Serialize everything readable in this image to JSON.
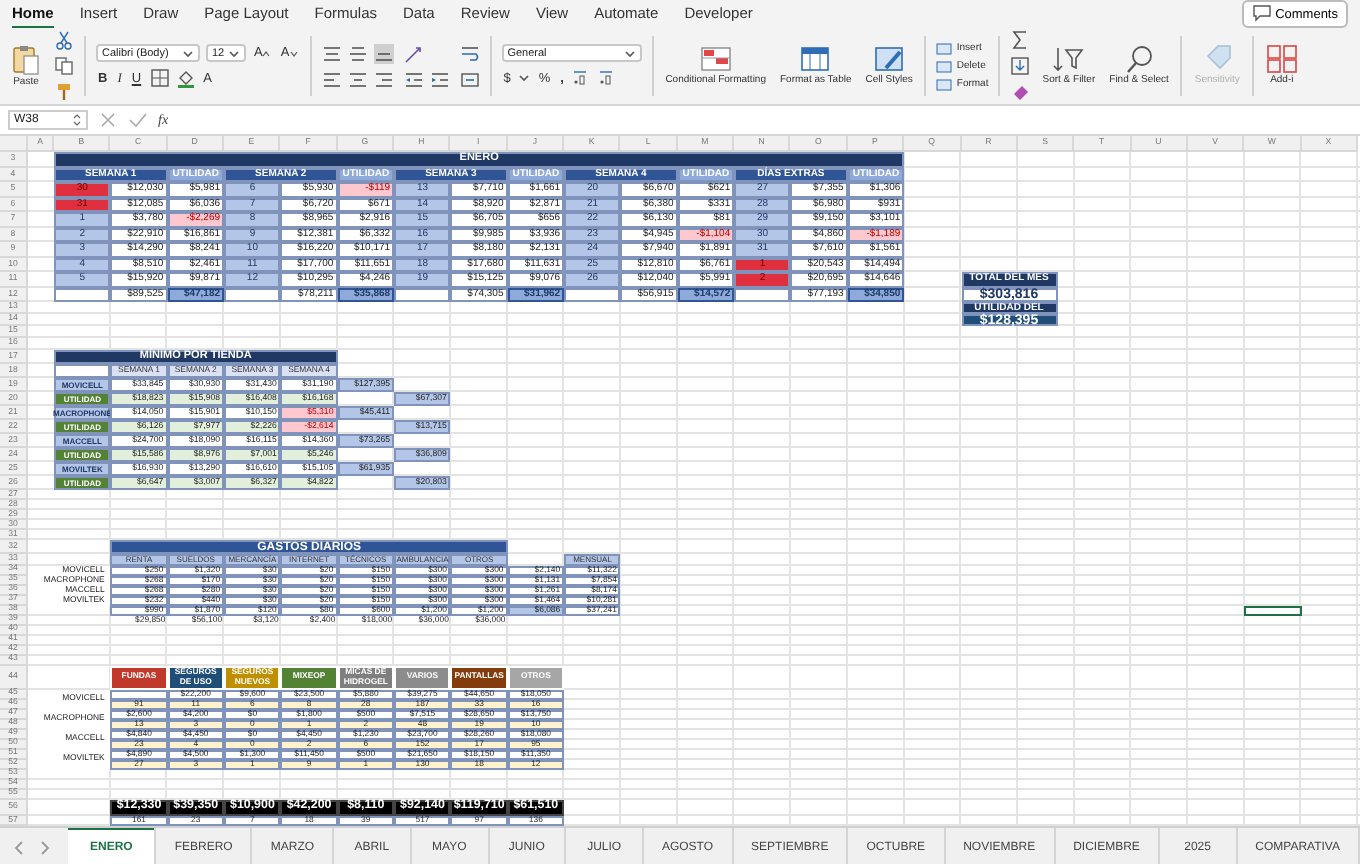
{
  "ribbon_tabs": [
    {
      "label": "Home",
      "selected": true
    },
    {
      "label": "Insert",
      "selected": false
    },
    {
      "label": "Draw",
      "selected": false
    },
    {
      "label": "Page Layout",
      "selected": false
    },
    {
      "label": "Formulas",
      "selected": false
    },
    {
      "label": "Data",
      "selected": false
    },
    {
      "label": "Review",
      "selected": false
    },
    {
      "label": "View",
      "selected": false
    },
    {
      "label": "Automate",
      "selected": false
    },
    {
      "label": "Developer",
      "selected": false
    }
  ],
  "comments_button": "Comments",
  "ribbon": {
    "paste": "Paste",
    "font": "Calibri (Body)",
    "font_size": "12",
    "grow_font": "A",
    "shrink_font": "A",
    "bold": "B",
    "italic": "I",
    "underline": "U",
    "font_color": "A",
    "number_format": "General",
    "currency": "$",
    "percent": "%",
    "comma": ",",
    "cells_menu": [
      "Insert",
      "Delete",
      "Format"
    ],
    "large_buttons": [
      {
        "kind": "conditional",
        "label": "Conditional Formatting",
        "disabled": false
      },
      {
        "kind": "table",
        "label": "Format as Table",
        "disabled": false
      },
      {
        "kind": "styles",
        "label": "Cell Styles",
        "disabled": false
      },
      {
        "kind": "sort",
        "label": "Sort & Filter",
        "disabled": false
      },
      {
        "kind": "find",
        "label": "Find & Select",
        "disabled": false
      },
      {
        "kind": "sensitivity",
        "label": "Sensitivity",
        "disabled": true
      },
      {
        "kind": "addins",
        "label": "Add-i",
        "disabled": false
      }
    ]
  },
  "formula_bar": {
    "name_box": "W38",
    "fx": "fx"
  },
  "column_letters": [
    "A",
    "B",
    "C",
    "D",
    "E",
    "F",
    "G",
    "H",
    "I",
    "J",
    "K",
    "L",
    "M",
    "N",
    "O",
    "P",
    "Q",
    "R",
    "S",
    "T",
    "U",
    "V",
    "W",
    "X"
  ],
  "row_numbers": [
    "3",
    "4",
    "5",
    "6",
    "7",
    "8",
    "9",
    "10",
    "11",
    "12",
    "13",
    "14",
    "15",
    "16",
    "17",
    "18",
    "19",
    "20",
    "21",
    "22",
    "23",
    "24",
    "25",
    "26",
    "27",
    "28",
    "29",
    "30",
    "31",
    "32",
    "33",
    "34",
    "35",
    "36",
    "37",
    "38",
    "39",
    "40",
    "41",
    "42",
    "43",
    "44",
    "45",
    "46",
    "47",
    "48",
    "49",
    "50",
    "51",
    "52",
    "53",
    "54",
    "55",
    "56",
    "57"
  ],
  "enero": {
    "title": "ENERO",
    "groups": [
      {
        "header": "SEMANA 1",
        "utility_header": "UTILIDAD",
        "total": "$89,525",
        "utility_total": "$47,182",
        "rows": [
          {
            "day": "30",
            "alert": true,
            "amount": "$12,030",
            "utility": "$5,981",
            "negative": false
          },
          {
            "day": "31",
            "alert": true,
            "amount": "$12,085",
            "utility": "$6,036",
            "negative": false
          },
          {
            "day": "1",
            "alert": false,
            "amount": "$3,780",
            "utility": "-$2,269",
            "negative": true
          },
          {
            "day": "2",
            "alert": false,
            "amount": "$22,910",
            "utility": "$16,861",
            "negative": false
          },
          {
            "day": "3",
            "alert": false,
            "amount": "$14,290",
            "utility": "$8,241",
            "negative": false
          },
          {
            "day": "4",
            "alert": false,
            "amount": "$8,510",
            "utility": "$2,461",
            "negative": false
          },
          {
            "day": "5",
            "alert": false,
            "amount": "$15,920",
            "utility": "$9,871",
            "negative": false
          }
        ]
      },
      {
        "header": "SEMANA 2",
        "utility_header": "UTILIDAD",
        "total": "$78,211",
        "utility_total": "$35,868",
        "rows": [
          {
            "day": "6",
            "alert": false,
            "amount": "$5,930",
            "utility": "-$119",
            "negative": true
          },
          {
            "day": "7",
            "alert": false,
            "amount": "$6,720",
            "utility": "$671",
            "negative": false
          },
          {
            "day": "8",
            "alert": false,
            "amount": "$8,965",
            "utility": "$2,916",
            "negative": false
          },
          {
            "day": "9",
            "alert": false,
            "amount": "$12,381",
            "utility": "$6,332",
            "negative": false
          },
          {
            "day": "10",
            "alert": false,
            "amount": "$16,220",
            "utility": "$10,171",
            "negative": false
          },
          {
            "day": "11",
            "alert": false,
            "amount": "$17,700",
            "utility": "$11,651",
            "negative": false
          },
          {
            "day": "12",
            "alert": false,
            "amount": "$10,295",
            "utility": "$4,246",
            "negative": false
          }
        ]
      },
      {
        "header": "SEMANA 3",
        "utility_header": "UTILIDAD",
        "total": "$74,305",
        "utility_total": "$31,962",
        "rows": [
          {
            "day": "13",
            "alert": false,
            "amount": "$7,710",
            "utility": "$1,661",
            "negative": false
          },
          {
            "day": "14",
            "alert": false,
            "amount": "$8,920",
            "utility": "$2,871",
            "negative": false
          },
          {
            "day": "15",
            "alert": false,
            "amount": "$6,705",
            "utility": "$656",
            "negative": false
          },
          {
            "day": "16",
            "alert": false,
            "amount": "$9,985",
            "utility": "$3,936",
            "negative": false
          },
          {
            "day": "17",
            "alert": false,
            "amount": "$8,180",
            "utility": "$2,131",
            "negative": false
          },
          {
            "day": "18",
            "alert": false,
            "amount": "$17,680",
            "utility": "$11,631",
            "negative": false
          },
          {
            "day": "19",
            "alert": false,
            "amount": "$15,125",
            "utility": "$9,076",
            "negative": false
          }
        ]
      },
      {
        "header": "SEMANA 4",
        "utility_header": "UTILIDAD",
        "total": "$56,915",
        "utility_total": "$14,572",
        "rows": [
          {
            "day": "20",
            "alert": false,
            "amount": "$6,670",
            "utility": "$621",
            "negative": false
          },
          {
            "day": "21",
            "alert": false,
            "amount": "$6,380",
            "utility": "$331",
            "negative": false
          },
          {
            "day": "22",
            "alert": false,
            "amount": "$6,130",
            "utility": "$81",
            "negative": false
          },
          {
            "day": "23",
            "alert": false,
            "amount": "$4,945",
            "utility": "-$1,104",
            "negative": true
          },
          {
            "day": "24",
            "alert": false,
            "amount": "$7,940",
            "utility": "$1,891",
            "negative": false
          },
          {
            "day": "25",
            "alert": false,
            "amount": "$12,810",
            "utility": "$6,761",
            "negative": false
          },
          {
            "day": "26",
            "alert": false,
            "amount": "$12,040",
            "utility": "$5,991",
            "negative": false
          }
        ]
      },
      {
        "header": "DÍAS EXTRAS",
        "utility_header": "UTILIDAD",
        "total": "$77,193",
        "utility_total": "$34,850",
        "rows": [
          {
            "day": "27",
            "alert": false,
            "amount": "$7,355",
            "utility": "$1,306",
            "negative": false
          },
          {
            "day": "28",
            "alert": false,
            "amount": "$6,980",
            "utility": "$931",
            "negative": false
          },
          {
            "day": "29",
            "alert": false,
            "amount": "$9,150",
            "utility": "$3,101",
            "negative": false
          },
          {
            "day": "30",
            "alert": false,
            "amount": "$4,860",
            "utility": "-$1,189",
            "negative": true
          },
          {
            "day": "31",
            "alert": false,
            "amount": "$7,610",
            "utility": "$1,561",
            "negative": false
          },
          {
            "day": "1",
            "alert": true,
            "amount": "$20,543",
            "utility": "$14,494",
            "negative": false
          },
          {
            "day": "2",
            "alert": true,
            "amount": "$20,695",
            "utility": "$14,646",
            "negative": false
          }
        ]
      }
    ]
  },
  "month_summary": {
    "total_label": "TOTAL DEL MES",
    "total": "$303,816",
    "utility_label": "UTILIDAD DEL",
    "utility": "$128,395"
  },
  "minimo": {
    "title": "MÍNIMO POR TIENDA",
    "headers": [
      "SEMANA 1",
      "SEMANA 2",
      "SEMANA 3",
      "SEMANA 4"
    ],
    "rows": [
      {
        "kind": "store",
        "label": "MOVICELL",
        "sum": "$127,395",
        "values": [
          {
            "text": "$33,845",
            "negative": false
          },
          {
            "text": "$30,930",
            "negative": false
          },
          {
            "text": "$31,430",
            "negative": false
          },
          {
            "text": "$31,190",
            "negative": false
          }
        ]
      },
      {
        "kind": "utility",
        "label": "UTILIDAD",
        "sum": "$67,307",
        "values": [
          {
            "text": "$18,823",
            "negative": false
          },
          {
            "text": "$15,908",
            "negative": false
          },
          {
            "text": "$16,408",
            "negative": false
          },
          {
            "text": "$16,168",
            "negative": false
          }
        ]
      },
      {
        "kind": "store",
        "label": "MACROPHONE",
        "sum": "$45,411",
        "values": [
          {
            "text": "$14,050",
            "negative": false
          },
          {
            "text": "$15,901",
            "negative": false
          },
          {
            "text": "$10,150",
            "negative": false
          },
          {
            "text": "$5,310",
            "negative": true
          }
        ]
      },
      {
        "kind": "utility",
        "label": "UTILIDAD",
        "sum": "$13,715",
        "values": [
          {
            "text": "$6,126",
            "negative": false
          },
          {
            "text": "$7,977",
            "negative": false
          },
          {
            "text": "$2,226",
            "negative": false
          },
          {
            "text": "-$2,614",
            "negative": true
          }
        ]
      },
      {
        "kind": "store",
        "label": "MACCELL",
        "sum": "$73,265",
        "values": [
          {
            "text": "$24,700",
            "negative": false
          },
          {
            "text": "$18,090",
            "negative": false
          },
          {
            "text": "$16,115",
            "negative": false
          },
          {
            "text": "$14,360",
            "negative": false
          }
        ]
      },
      {
        "kind": "utility",
        "label": "UTILIDAD",
        "sum": "$36,809",
        "values": [
          {
            "text": "$15,586",
            "negative": false
          },
          {
            "text": "$8,976",
            "negative": false
          },
          {
            "text": "$7,001",
            "negative": false
          },
          {
            "text": "$5,246",
            "negative": false
          }
        ]
      },
      {
        "kind": "store",
        "label": "MOVILTEK",
        "sum": "$61,935",
        "values": [
          {
            "text": "$16,930",
            "negative": false
          },
          {
            "text": "$13,290",
            "negative": false
          },
          {
            "text": "$16,610",
            "negative": false
          },
          {
            "text": "$15,105",
            "negative": false
          }
        ]
      },
      {
        "kind": "utility",
        "label": "UTILIDAD",
        "sum": "$20,803",
        "values": [
          {
            "text": "$6,647",
            "negative": false
          },
          {
            "text": "$3,007",
            "negative": false
          },
          {
            "text": "$6,327",
            "negative": false
          },
          {
            "text": "$4,822",
            "negative": false
          }
        ]
      }
    ]
  },
  "gastos": {
    "title": "GASTOS DIARIOS",
    "headers": [
      "RENTA",
      "SUELDOS",
      "MERCANCÍA",
      "INTERNET",
      "TÉCNICOS",
      "AMBULANCIA",
      "OTROS"
    ],
    "monthly_header": "MENSUAL",
    "rows": [
      {
        "label": "MOVICELL",
        "values": [
          "$250",
          "$1,320",
          "$30",
          "$20",
          "$150",
          "$300",
          "$300"
        ],
        "daily": "$2,140",
        "monthly": "$11,322"
      },
      {
        "label": "MACROPHONE",
        "values": [
          "$268",
          "$170",
          "$30",
          "$20",
          "$150",
          "$300",
          "$300"
        ],
        "daily": "$1,131",
        "monthly": "$7,854"
      },
      {
        "label": "MACCELL",
        "values": [
          "$268",
          "$280",
          "$30",
          "$20",
          "$150",
          "$300",
          "$300"
        ],
        "daily": "$1,261",
        "monthly": "$8,174"
      },
      {
        "label": "MOVILTEK",
        "values": [
          "$232",
          "$440",
          "$30",
          "$20",
          "$150",
          "$300",
          "$300"
        ],
        "daily": "$1,464",
        "monthly": "$10,281"
      }
    ],
    "totals": {
      "values": [
        "$990",
        "$1,870",
        "$120",
        "$80",
        "$600",
        "$1,200",
        "$1,200"
      ],
      "daily": "$6,086",
      "monthly": "$37,241"
    },
    "month_values": [
      "$29,850",
      "$56,100",
      "$3,120",
      "$2,400",
      "$18,000",
      "$36,000",
      "$36,000"
    ]
  },
  "sales": {
    "headers": [
      {
        "label": "FUNDAS",
        "color": "#c0392b"
      },
      {
        "label": "SEGUROS DE USO",
        "color": "#1f4e79"
      },
      {
        "label": "SEGUROS NUEVOS",
        "color": "#bf8f00"
      },
      {
        "label": "MIXEOP",
        "color": "#548235"
      },
      {
        "label": "MICAS DE HIDROGEL",
        "color": "#7f7f7f"
      },
      {
        "label": "VARIOS",
        "color": "#8c8c8c"
      },
      {
        "label": "PANTALLAS",
        "color": "#843c0c"
      },
      {
        "label": "OTROS",
        "color": "#a6a6a6"
      }
    ],
    "stores": [
      {
        "label": "MOVICELL",
        "cells": [
          {
            "count": "91"
          },
          {
            "amount": "$22,200",
            "count": "11"
          },
          {
            "amount": "$9,600",
            "count": "6"
          },
          {
            "amount": "$23,500",
            "count": "8"
          },
          {
            "amount": "$5,880",
            "count": "28"
          },
          {
            "amount": "$39,275",
            "count": "187"
          },
          {
            "amount": "$44,650",
            "count": "33"
          },
          {
            "amount": "$18,050",
            "count": "16"
          }
        ]
      },
      {
        "label": "MACROPHONE",
        "cells": [
          {
            "amount": "$2,600",
            "count": "13"
          },
          {
            "amount": "$4,200",
            "count": "3"
          },
          {
            "amount": "$0",
            "count": "0"
          },
          {
            "amount": "$1,800",
            "count": "1"
          },
          {
            "amount": "$500",
            "count": "2"
          },
          {
            "amount": "$7,515",
            "count": "48"
          },
          {
            "amount": "$28,650",
            "count": "19"
          },
          {
            "amount": "$13,750",
            "count": "10"
          }
        ]
      },
      {
        "label": "MACCELL",
        "cells": [
          {
            "amount": "$4,840",
            "count": "23"
          },
          {
            "amount": "$4,450",
            "count": "4"
          },
          {
            "amount": "$0",
            "count": "0"
          },
          {
            "amount": "$4,450",
            "count": "2"
          },
          {
            "amount": "$1,230",
            "count": "6"
          },
          {
            "amount": "$23,700",
            "count": "152"
          },
          {
            "amount": "$28,260",
            "count": "17"
          },
          {
            "amount": "$18,080",
            "count": "95"
          }
        ]
      },
      {
        "label": "MOVILTEK",
        "cells": [
          {
            "amount": "$4,890",
            "count": "27"
          },
          {
            "amount": "$4,500",
            "count": "3"
          },
          {
            "amount": "$1,300",
            "count": "1"
          },
          {
            "amount": "$11,450",
            "count": "9"
          },
          {
            "amount": "$500",
            "count": "1"
          },
          {
            "amount": "$21,650",
            "count": "130"
          },
          {
            "amount": "$18,150",
            "count": "18"
          },
          {
            "amount": "$11,350",
            "count": "12"
          }
        ]
      }
    ],
    "totals": [
      "$12,330",
      "$39,350",
      "$10,900",
      "$42,200",
      "$8,110",
      "$92,140",
      "$119,710",
      "$61,510"
    ],
    "total_counts": [
      "161",
      "23",
      "7",
      "18",
      "39",
      "517",
      "97",
      "136"
    ]
  },
  "sheet_tabs": [
    {
      "label": "ENERO",
      "selected": true
    },
    {
      "label": "FEBRERO",
      "selected": false
    },
    {
      "label": "MARZO",
      "selected": false
    },
    {
      "label": "ABRIL",
      "selected": false
    },
    {
      "label": "MAYO",
      "selected": false
    },
    {
      "label": "JUNIO",
      "selected": false
    },
    {
      "label": "JULIO",
      "selected": false
    },
    {
      "label": "AGOSTO",
      "selected": false
    },
    {
      "label": "SEPTIEMBRE",
      "selected": false
    },
    {
      "label": "OCTUBRE",
      "selected": false
    },
    {
      "label": "NOVIEMBRE",
      "selected": false
    },
    {
      "label": "DICIEMBRE",
      "selected": false
    },
    {
      "label": "2025",
      "selected": false
    },
    {
      "label": "COMPARATIVA",
      "selected": false
    }
  ]
}
